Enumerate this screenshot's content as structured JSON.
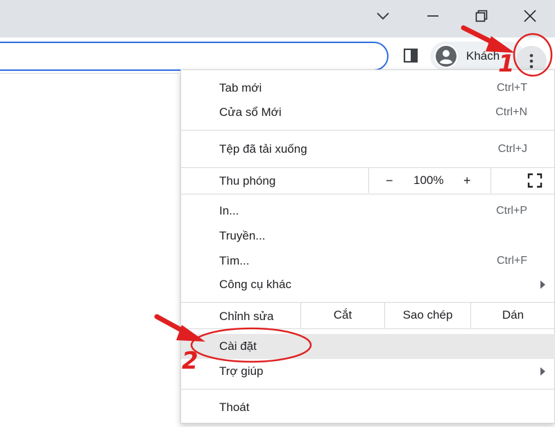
{
  "window": {
    "title_buttons": [
      "tab-search",
      "minimize",
      "restore",
      "close"
    ]
  },
  "toolbar": {
    "profile_name": "Khách",
    "menu_icon": "three-dots-vertical-icon"
  },
  "menu": {
    "new_tab": {
      "label": "Tab mới",
      "shortcut": "Ctrl+T"
    },
    "new_window": {
      "label": "Cửa sổ Mới",
      "shortcut": "Ctrl+N"
    },
    "downloads": {
      "label": "Tệp đã tải xuống",
      "shortcut": "Ctrl+J"
    },
    "zoom": {
      "label": "Thu phóng",
      "minus": "−",
      "value": "100%",
      "plus": "+"
    },
    "print": {
      "label": "In...",
      "shortcut": "Ctrl+P"
    },
    "cast": {
      "label": "Truyền..."
    },
    "find": {
      "label": "Tìm...",
      "shortcut": "Ctrl+F"
    },
    "more_tools": {
      "label": "Công cụ khác"
    },
    "edit": {
      "label": "Chỉnh sửa",
      "cut": "Cắt",
      "copy": "Sao chép",
      "paste": "Dán"
    },
    "settings": {
      "label": "Cài đặt"
    },
    "help": {
      "label": "Trợ giúp"
    },
    "exit": {
      "label": "Thoát"
    }
  },
  "annotations": {
    "step1": "1",
    "step2": "2",
    "color": "#e02020"
  }
}
